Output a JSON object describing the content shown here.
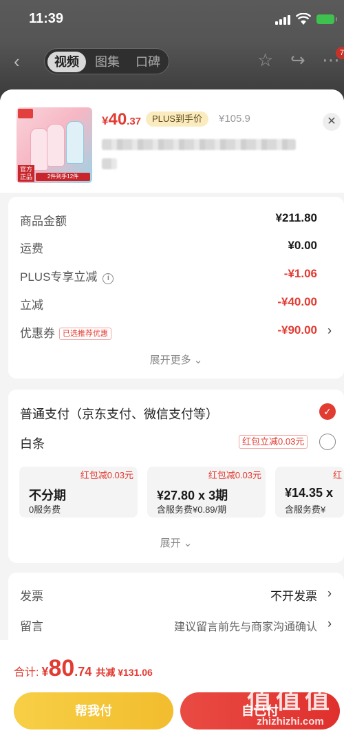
{
  "status_bar": {
    "time": "11:39"
  },
  "bg_nav": {
    "tabs": [
      {
        "label": "视频"
      },
      {
        "label": "图集"
      },
      {
        "label": "口碑"
      }
    ],
    "badge": "7"
  },
  "product": {
    "price_currency": "¥",
    "price_int": "40",
    "price_dec": ".37",
    "plus_tag": "PLUS到手价",
    "orig_price": "¥105.9",
    "thumb_official": "官方正品",
    "thumb_promo": "2件到手12件"
  },
  "summary": {
    "rows": [
      {
        "label": "商品金额",
        "value": "¥211.80"
      },
      {
        "label": "运费",
        "value": "¥0.00"
      },
      {
        "label": "PLUS专享立减",
        "value": "-¥1.06"
      },
      {
        "label": "立减",
        "value": "-¥40.00"
      },
      {
        "label": "优惠券",
        "value": "-¥90.00",
        "tag": "已选推荐优惠"
      }
    ],
    "info_icon": "i",
    "expand_more": "展开更多 ⌄"
  },
  "payment": {
    "normal_title": "普通支付（京东支付、微信支付等）",
    "baitiao": "白条",
    "baitiao_tag": "红包立减0.03元",
    "installments": [
      {
        "tag": "红包减0.03元",
        "title": "不分期",
        "sub": "0服务费"
      },
      {
        "tag": "红包减0.03元",
        "title": "¥27.80 x 3期",
        "sub": "含服务费¥0.89/期"
      },
      {
        "tag": "红",
        "title": "¥14.35 x",
        "sub": "含服务费¥"
      }
    ],
    "expand": "展开 ⌄"
  },
  "extra": {
    "invoice_label": "发票",
    "invoice_value": "不开发票",
    "message_label": "留言",
    "message_placeholder": "建议留言前先与商家沟通确认"
  },
  "bottom": {
    "total_label": "合计:",
    "total_currency": "¥",
    "total_int": "80",
    "total_dec": ".74",
    "saved": "共减 ¥131.06",
    "help_button": "帮我付",
    "pay_button": "自己付",
    "watermark_big": "值值值",
    "watermark_url": "zhizhizhi.com"
  },
  "colors": {
    "accent": "#e23b32",
    "help_yellow": "#f7cf46",
    "plus_tag_bg": "#fbecc0"
  }
}
